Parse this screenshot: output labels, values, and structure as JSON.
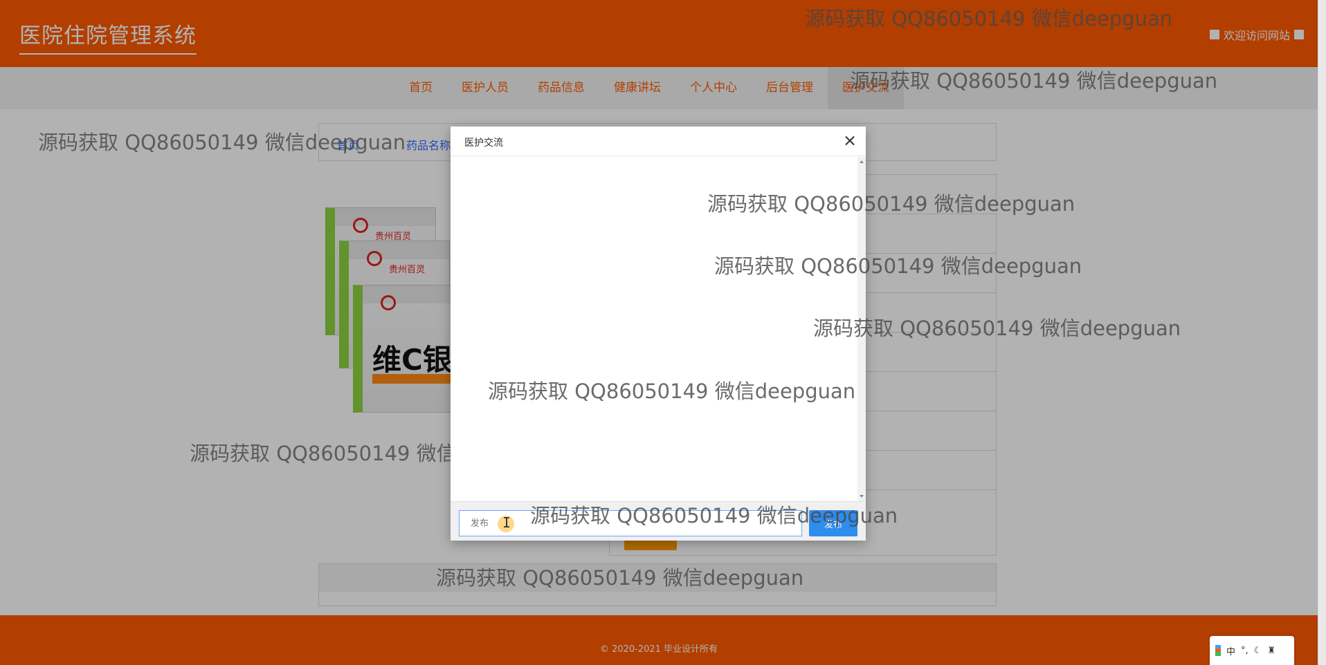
{
  "header": {
    "site_title": "医院住院管理系统",
    "welcome": "欢迎访问网站"
  },
  "nav": {
    "items": [
      {
        "label": "首页"
      },
      {
        "label": "医护人员"
      },
      {
        "label": "药品信息"
      },
      {
        "label": "健康讲坛"
      },
      {
        "label": "个人中心"
      },
      {
        "label": "后台管理"
      },
      {
        "label": "医护交流",
        "active": true
      }
    ]
  },
  "breadcrumb": {
    "home": "首页",
    "current": "药品名称"
  },
  "product_image": {
    "brand": "贵州百灵",
    "name_partial": "维C银"
  },
  "modal": {
    "title": "医护交流",
    "input_placeholder": "发布",
    "send_label": "发布"
  },
  "footer": {
    "copyright": "© 2020-2021 毕业设计所有"
  },
  "watermark": "源码获取 QQ86050149 微信deepguan",
  "ime": {
    "lang": "中",
    "icons": [
      "punctuation-icon",
      "moon-icon",
      "shirt-icon"
    ]
  },
  "colors": {
    "brand": "#ff5a00",
    "send_button": "#2e8ded",
    "link": "#2e6cff"
  }
}
